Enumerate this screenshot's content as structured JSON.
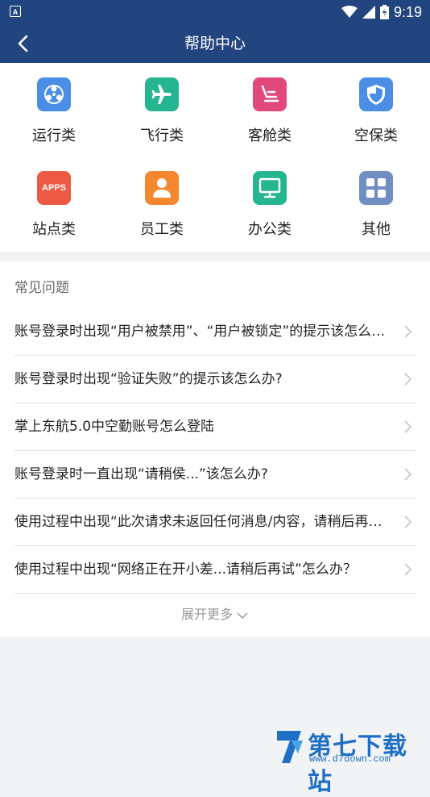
{
  "status_bar": {
    "time": "9:19",
    "app_badge": "A"
  },
  "nav": {
    "title": "帮助中心"
  },
  "categories": [
    {
      "label": "运行类",
      "icon": "network-icon",
      "color": "#4a8ee6"
    },
    {
      "label": "飞行类",
      "icon": "airplane-icon",
      "color": "#25b590"
    },
    {
      "label": "客舱类",
      "icon": "seat-icon",
      "color": "#e0497a"
    },
    {
      "label": "空保类",
      "icon": "shield-icon",
      "color": "#4a8ee6"
    },
    {
      "label": "站点类",
      "icon": "apps-icon",
      "color": "#ec5a44",
      "icon_text": "APPS"
    },
    {
      "label": "员工类",
      "icon": "person-icon",
      "color": "#f5872f"
    },
    {
      "label": "办公类",
      "icon": "monitor-icon",
      "color": "#25b590"
    },
    {
      "label": "其他",
      "icon": "grid-icon",
      "color": "#6f8fc4"
    }
  ],
  "faq": {
    "heading": "常见问题",
    "items": [
      "账号登录时出现“用户被禁用”、“用户被锁定”的提示该怎么办？",
      "账号登录时出现“验证失败”的提示该怎么办?",
      "掌上东航5.0中空勤账号怎么登陆",
      "账号登录时一直出现“请稍侯...”该怎么办?",
      "使用过程中出现“此次请求未返回任何消息/内容，请稍后再试”怎么办？",
      "使用过程中出现“网络正在开小差...请稍后再试”怎么办？"
    ],
    "more_label": "展开更多"
  },
  "watermark": {
    "name": "第七下载站",
    "url": "www.d7down.com"
  }
}
